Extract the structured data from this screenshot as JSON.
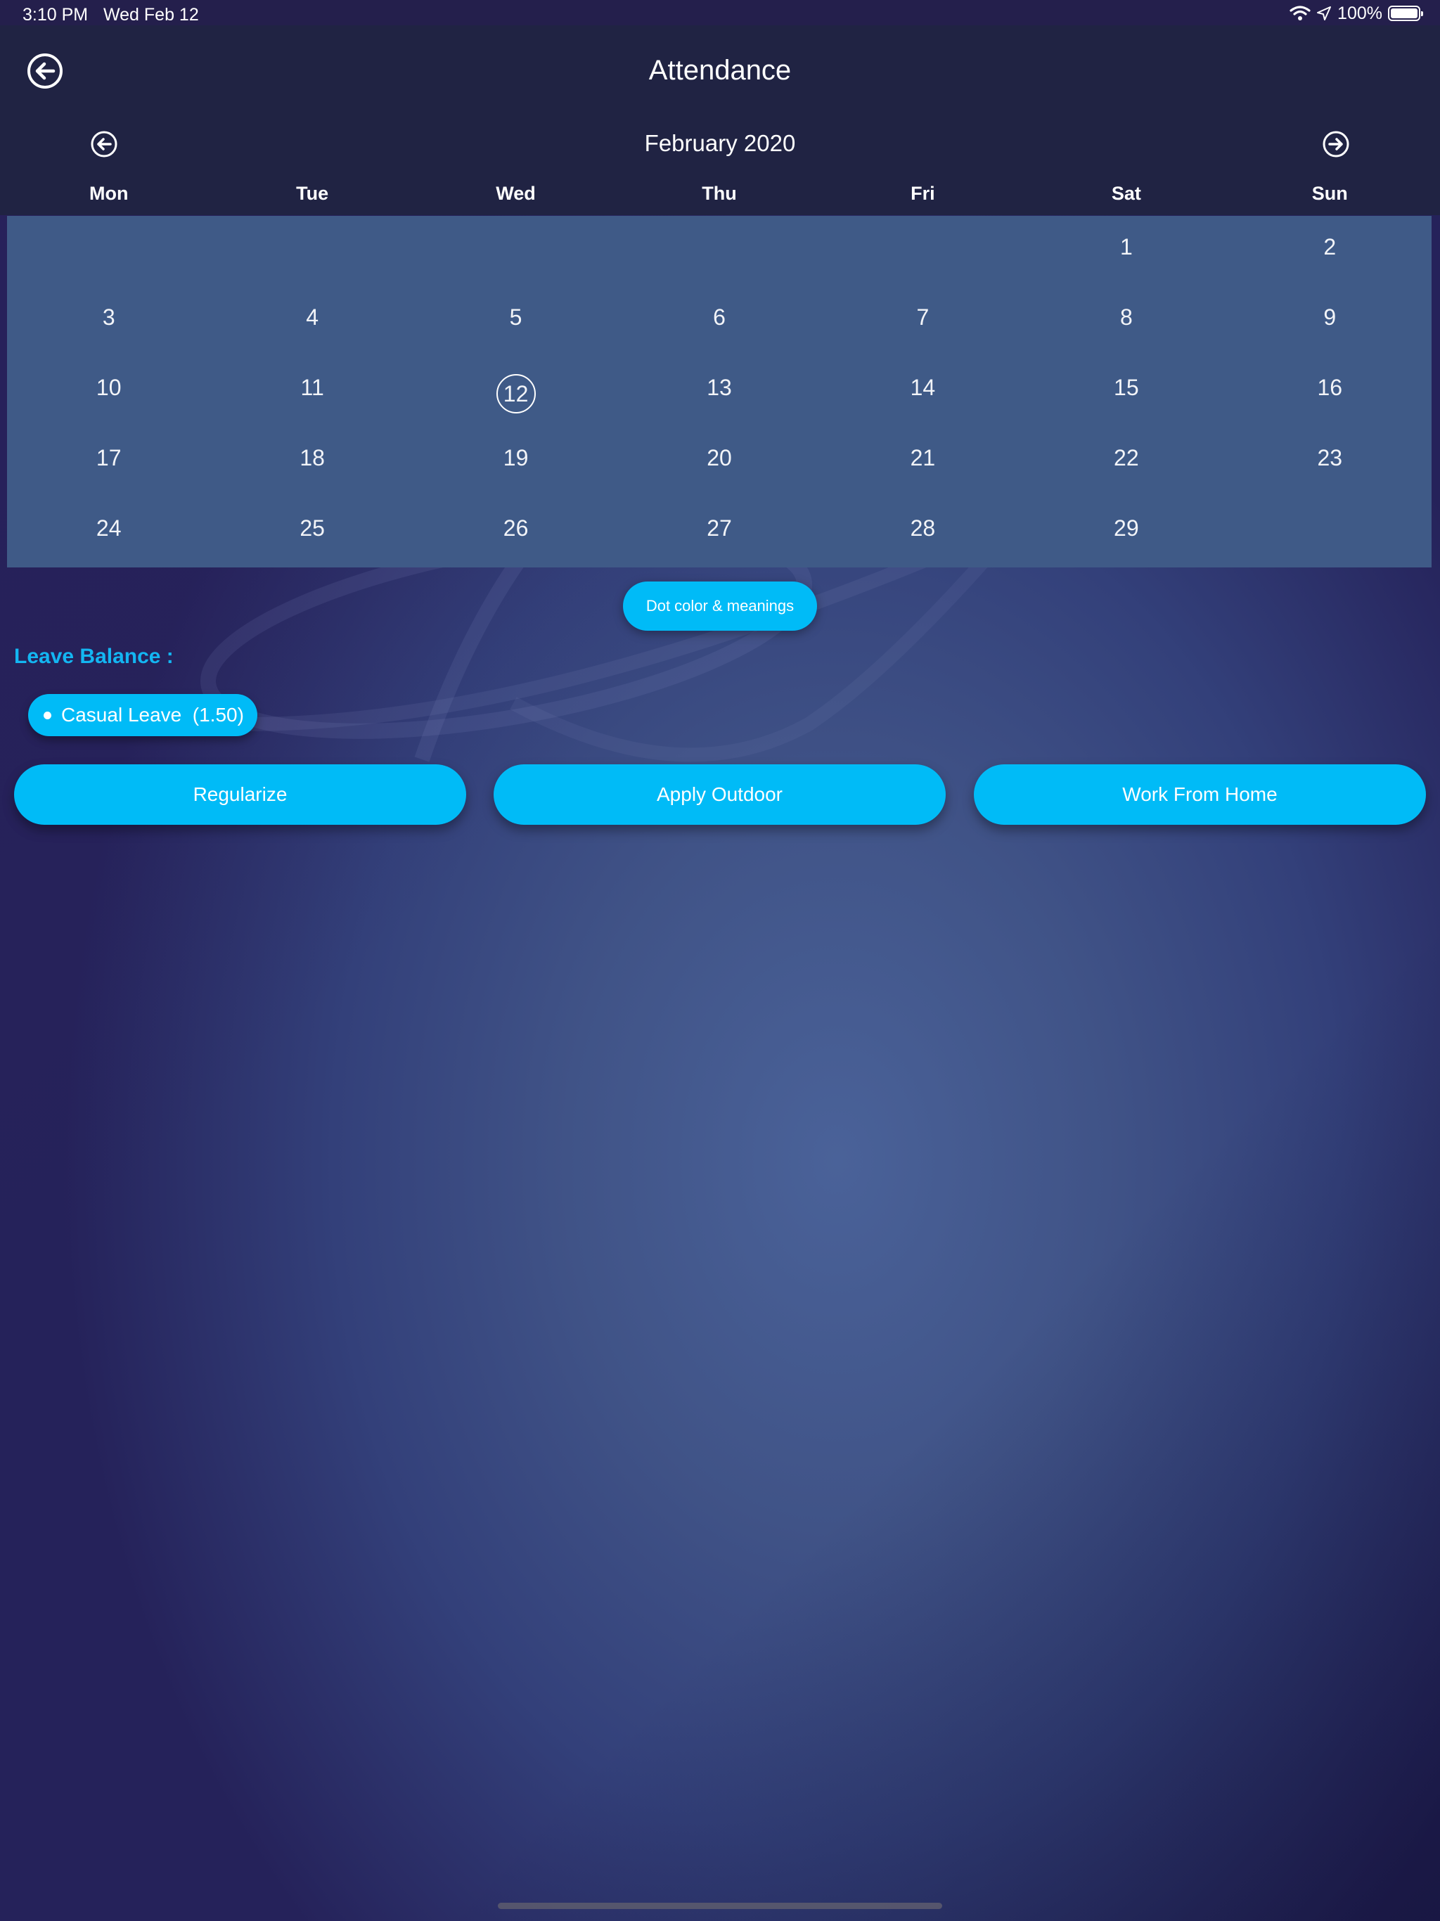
{
  "status_bar": {
    "time": "3:10 PM",
    "date": "Wed Feb 12",
    "battery": "100%"
  },
  "header": {
    "title": "Attendance"
  },
  "calendar": {
    "month_label": "February 2020",
    "weekdays": [
      "Mon",
      "Tue",
      "Wed",
      "Thu",
      "Fri",
      "Sat",
      "Sun"
    ],
    "weeks": [
      [
        "",
        "",
        "",
        "",
        "",
        "1",
        "2"
      ],
      [
        "3",
        "4",
        "5",
        "6",
        "7",
        "8",
        "9"
      ],
      [
        "10",
        "11",
        "12",
        "13",
        "14",
        "15",
        "16"
      ],
      [
        "17",
        "18",
        "19",
        "20",
        "21",
        "22",
        "23"
      ],
      [
        "24",
        "25",
        "26",
        "27",
        "28",
        "29",
        ""
      ]
    ],
    "selected_day": "12"
  },
  "legend_button": "Dot color & meanings",
  "leave_balance": {
    "title": "Leave Balance :",
    "items": [
      {
        "label": "Casual Leave  (1.50)"
      }
    ]
  },
  "actions": [
    "Regularize",
    "Apply Outdoor",
    "Work From Home"
  ],
  "colors": {
    "accent": "#00bbf7",
    "calendar_bg": "#3f5a87",
    "header_bg": "#202343",
    "leave_title": "#13b6f2"
  },
  "icons": {
    "back": "arrow-left-circle-icon",
    "prev_month": "arrow-left-circle-icon",
    "next_month": "arrow-right-circle-icon",
    "wifi": "wifi-icon",
    "location": "location-arrow-icon",
    "battery": "battery-icon"
  }
}
